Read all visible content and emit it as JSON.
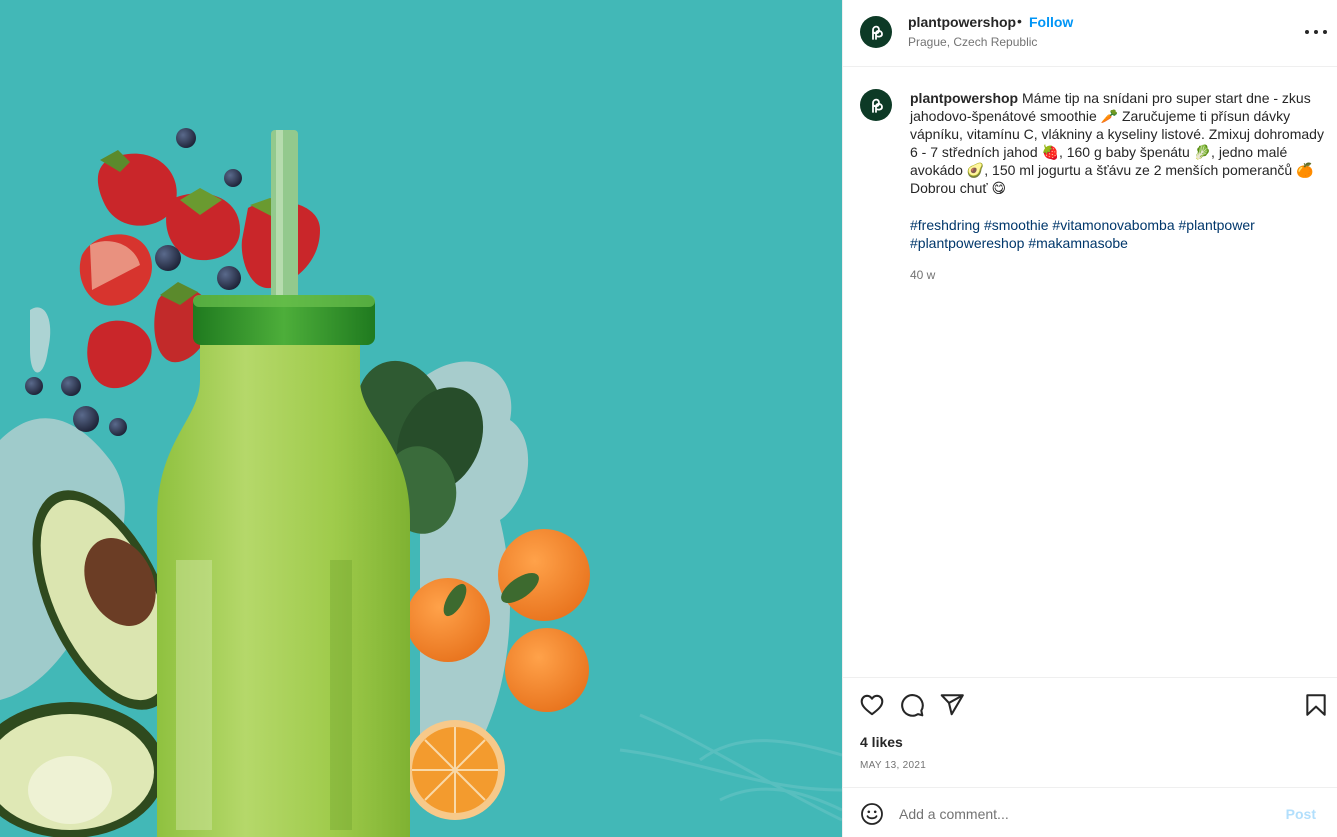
{
  "post_image": {
    "background_color": "#42b8b7",
    "depicted": [
      "strawberries",
      "blueberries",
      "spinach leaves",
      "avocado",
      "oranges",
      "green smoothie bottle",
      "straw"
    ]
  },
  "header": {
    "username": "plantpowershop",
    "separator": "•",
    "follow_label": "Follow",
    "location": "Prague, Czech Republic",
    "more_icon": "more-horizontal-icon"
  },
  "caption": {
    "username": "plantpowershop",
    "text": "Máme tip na snídani pro super start dne - zkus jahodovo-špenátové smoothie 🥕 Zaručujeme ti přísun dávky vápníku, vitamínu C, vlákniny a kyseliny listové. Zmixuj dohromady 6 - 7 středních jahod 🍓, 160 g baby špenátu 🥬, jedno malé avokádo 🥑, 150 ml jogurtu a šťávu ze 2 menších pomerančů 🍊 Dobrou chuť 😋",
    "hashtags": [
      "#freshdring",
      "#smoothie",
      "#vitamonovabomba",
      "#plantpower",
      "#plantpowereshop",
      "#makamnasobe"
    ],
    "age": "40 w"
  },
  "actions": {
    "like_icon": "heart-icon",
    "comment_icon": "comment-icon",
    "share_icon": "share-icon",
    "save_icon": "bookmark-icon",
    "likes_text": "4 likes",
    "date": "MAY 13, 2021"
  },
  "comment_box": {
    "emoji_icon": "emoji-icon",
    "placeholder": "Add a comment...",
    "post_label": "Post"
  },
  "colors": {
    "accent": "#0095f6",
    "hashtag": "#00376b",
    "muted": "#737373",
    "post_disabled": "#b2dffc",
    "avatar_bg": "#0d3a26"
  }
}
